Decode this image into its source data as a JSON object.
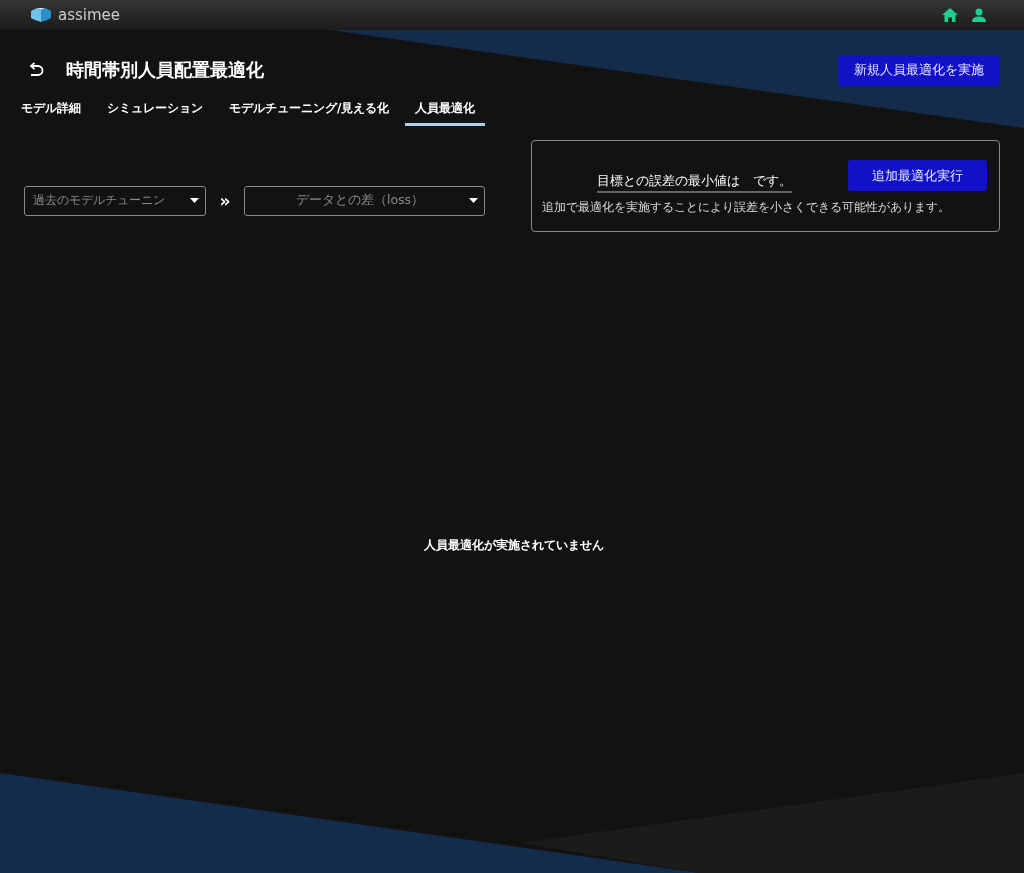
{
  "app": {
    "logo_text": "assimee"
  },
  "header": {
    "title": "時間帯別人員配置最適化",
    "action_button": "新規人員最適化を実施"
  },
  "tabs": [
    {
      "label": "モデル詳細",
      "selected": false
    },
    {
      "label": "シミュレーション",
      "selected": false
    },
    {
      "label": "モデルチューニング/見える化",
      "selected": false
    },
    {
      "label": "人員最適化",
      "selected": true
    }
  ],
  "filters": {
    "history_select": {
      "value": "過去のモデルチューニン"
    },
    "separator": "»",
    "metric_select": {
      "value": "データとの差（loss）"
    }
  },
  "result_card": {
    "summary": "目標との誤差の最小値は　です。",
    "button": "追加最適化実行",
    "note": "追加で最適化を実施することにより誤差を小さくできる可能性があります。"
  },
  "empty_message": "人員最適化が実施されていません"
}
